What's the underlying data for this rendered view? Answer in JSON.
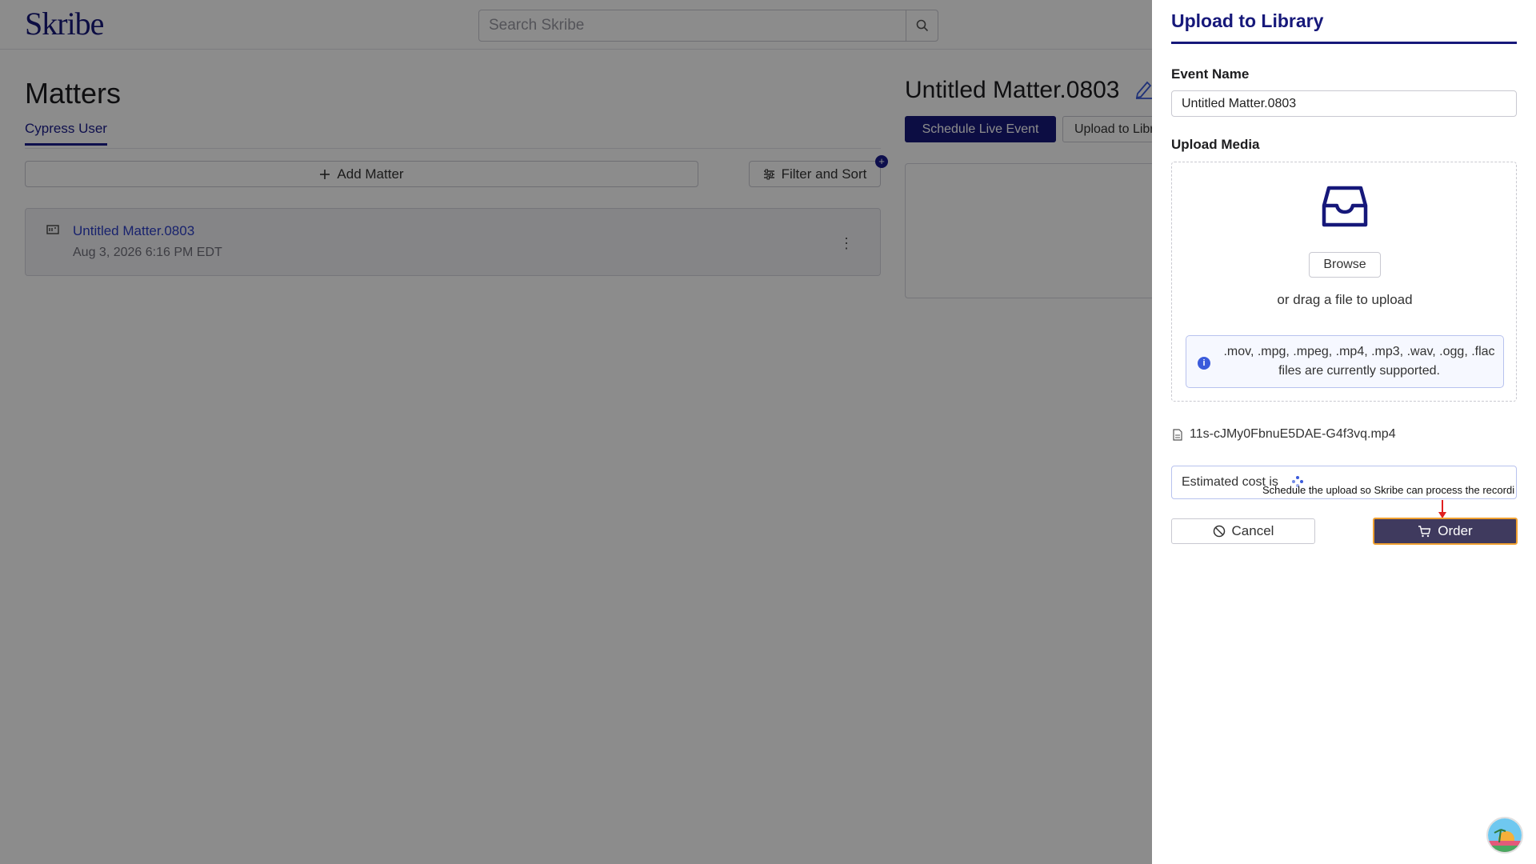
{
  "app": {
    "logo": "Skribe",
    "search_placeholder": "Search Skribe"
  },
  "matters": {
    "title": "Matters",
    "tab": "Cypress User",
    "add_matter_label": "Add Matter",
    "filter_label": "Filter and Sort",
    "filter_badge": "+",
    "items": [
      {
        "name": "Untitled Matter.0803",
        "date": "Aug 3, 2026 6:16 PM EDT"
      }
    ]
  },
  "detail": {
    "title": "Untitled Matter.0803",
    "schedule_label": "Schedule Live Event",
    "upload_label": "Upload to Library"
  },
  "drawer": {
    "title": "Upload to Library",
    "event_name_label": "Event Name",
    "event_name_value": "Untitled Matter.0803",
    "upload_media_label": "Upload Media",
    "browse_label": "Browse",
    "drag_text": "or drag a file to upload",
    "supported_text": ".mov, .mpg, .mpeg, .mp4, .mp3, .wav, .ogg, .flac files are currently supported.",
    "info_icon": "i",
    "file_name": "11s-cJMy0FbnuE5DAE-G4f3vq.mp4",
    "estimated_cost_text": "Estimated cost is",
    "cancel_label": "Cancel",
    "order_label": "Order",
    "tooltip_text": "Schedule the upload so Skribe can process the recordi"
  },
  "colors": {
    "brand": "#16187a",
    "link": "#2d3fc7",
    "order_bg": "#3f3a5e",
    "order_border": "#f0a030",
    "annotation_arrow": "#e02020"
  },
  "icons": [
    "search-icon",
    "plus-icon",
    "sliders-icon",
    "matter-icon",
    "kebab-icon",
    "edit-icon",
    "inbox-icon",
    "info-icon",
    "file-icon",
    "ban-icon",
    "cart-icon",
    "avatar"
  ]
}
